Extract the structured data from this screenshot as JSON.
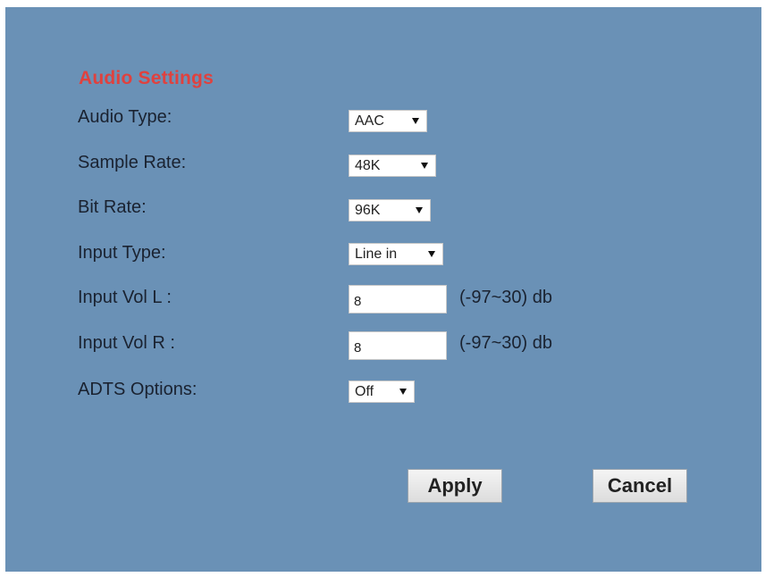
{
  "title": "Audio Settings",
  "fields": {
    "audio_type": {
      "label": "Audio Type:",
      "value": "AAC"
    },
    "sample_rate": {
      "label": "Sample Rate:",
      "value": "48K"
    },
    "bit_rate": {
      "label": "Bit Rate:",
      "value": "96K"
    },
    "input_type": {
      "label": "Input Type:",
      "value": "Line in"
    },
    "input_vol_l": {
      "label": "Input Vol L :",
      "value": "8",
      "unit": "(-97~30) db"
    },
    "input_vol_r": {
      "label": "Input Vol R :",
      "value": "8",
      "unit": "(-97~30) db"
    },
    "adts_options": {
      "label": "ADTS Options:",
      "value": "Off"
    }
  },
  "buttons": {
    "apply": "Apply",
    "cancel": "Cancel"
  },
  "colors": {
    "panel_background": "#6a91b6",
    "title": "#e0413e"
  }
}
